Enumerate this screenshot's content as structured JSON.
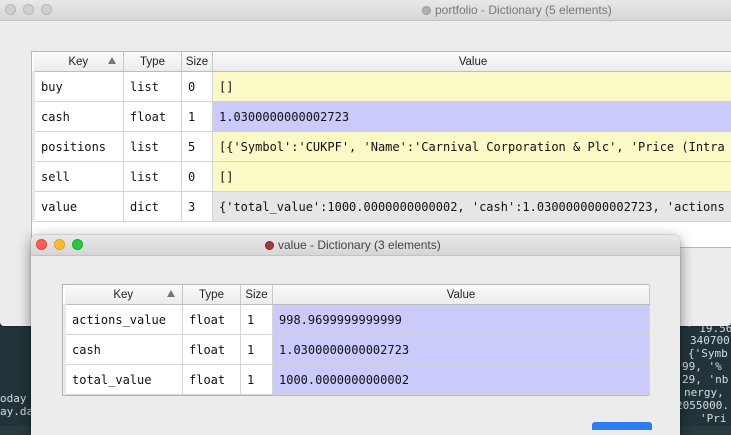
{
  "back_window": {
    "title": "portfolio - Dictionary (5 elements)",
    "headers": {
      "key": "Key",
      "type": "Type",
      "size": "Size",
      "value": "Value"
    },
    "rows": [
      {
        "key": "buy",
        "type": "list",
        "size": "0",
        "value": "[]",
        "color": "#fbfac7"
      },
      {
        "key": "cash",
        "type": "float",
        "size": "1",
        "value": "1.0300000000002723",
        "color": "#cacbfa"
      },
      {
        "key": "positions",
        "type": "list",
        "size": "5",
        "value": "[{'Symbol':'CUKPF', 'Name':'Carnival Corporation & Plc', 'Price (Intra",
        "color": "#fbfac7"
      },
      {
        "key": "sell",
        "type": "list",
        "size": "0",
        "value": "[]",
        "color": "#fbfac7"
      },
      {
        "key": "value",
        "type": "dict",
        "size": "3",
        "value": "{'total_value':1000.0000000000002, 'cash':1.0300000000002723, 'actions",
        "color": "#e6e6e6"
      }
    ]
  },
  "front_window": {
    "title": "value - Dictionary (3 elements)",
    "headers": {
      "key": "Key",
      "type": "Type",
      "size": "Size",
      "value": "Value"
    },
    "rows": [
      {
        "key": "actions_value",
        "type": "float",
        "size": "1",
        "value": "998.9699999999999",
        "color": "#cacbfa"
      },
      {
        "key": "cash",
        "type": "float",
        "size": "1",
        "value": "1.0300000000002723",
        "color": "#cacbfa"
      },
      {
        "key": "total_value",
        "type": "float",
        "size": "1",
        "value": "1000.0000000000002",
        "color": "#cacbfa"
      }
    ]
  },
  "terminal": {
    "lines": [
      "' 19.56",
      "340700",
      "{'Symb",
      "99, '%",
      "29, 'nb",
      "nergy,",
      "2055000.",
      "'Pri",
      "oday",
      "ay.da"
    ]
  }
}
